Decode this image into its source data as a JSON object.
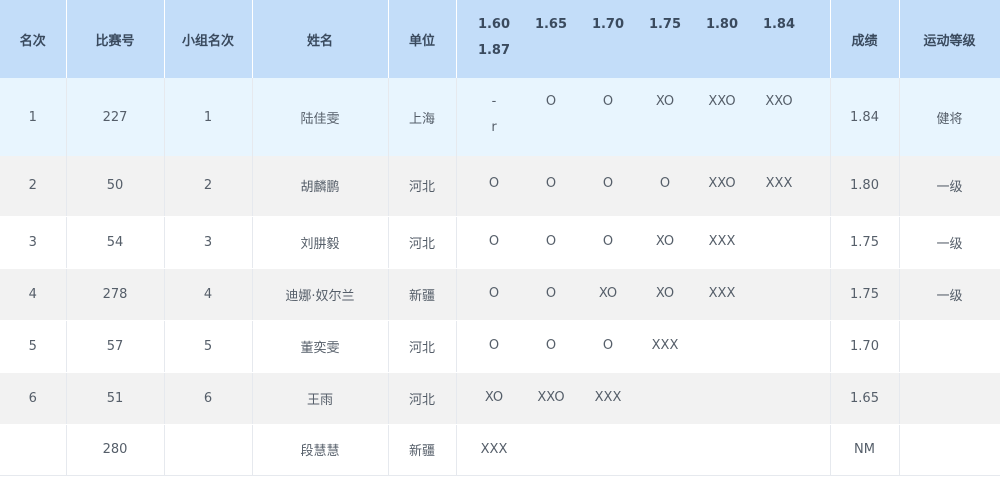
{
  "columns": {
    "rank": "名次",
    "bib": "比赛号",
    "group_rank": "小组名次",
    "name": "姓名",
    "unit": "单位",
    "result": "成绩",
    "grade": "运动等级"
  },
  "heights": [
    "1.60",
    "1.65",
    "1.70",
    "1.75",
    "1.80",
    "1.84"
  ],
  "heights_row2": "1.87",
  "rows": [
    {
      "rank": "1",
      "bib": "227",
      "group_rank": "1",
      "name": "陆佳雯",
      "unit": "上海",
      "attempts": [
        "-",
        "O",
        "O",
        "XO",
        "XXO",
        "XXO"
      ],
      "attempts_extra": "r",
      "result": "1.84",
      "grade": "健将"
    },
    {
      "rank": "2",
      "bib": "50",
      "group_rank": "2",
      "name": "胡麟鹏",
      "unit": "河北",
      "attempts": [
        "O",
        "O",
        "O",
        "O",
        "XXO",
        "XXX"
      ],
      "attempts_extra": "",
      "result": "1.80",
      "grade": "一级"
    },
    {
      "rank": "3",
      "bib": "54",
      "group_rank": "3",
      "name": "刘肼毅",
      "unit": "河北",
      "attempts": [
        "O",
        "O",
        "O",
        "XO",
        "XXX",
        ""
      ],
      "attempts_extra": "",
      "result": "1.75",
      "grade": "一级"
    },
    {
      "rank": "4",
      "bib": "278",
      "group_rank": "4",
      "name": "迪娜·奴尔兰",
      "unit": "新疆",
      "attempts": [
        "O",
        "O",
        "XO",
        "XO",
        "XXX",
        ""
      ],
      "attempts_extra": "",
      "result": "1.75",
      "grade": "一级"
    },
    {
      "rank": "5",
      "bib": "57",
      "group_rank": "5",
      "name": "董奕雯",
      "unit": "河北",
      "attempts": [
        "O",
        "O",
        "O",
        "XXX",
        "",
        ""
      ],
      "attempts_extra": "",
      "result": "1.70",
      "grade": ""
    },
    {
      "rank": "6",
      "bib": "51",
      "group_rank": "6",
      "name": "王雨",
      "unit": "河北",
      "attempts": [
        "XO",
        "XXO",
        "XXX",
        "",
        "",
        ""
      ],
      "attempts_extra": "",
      "result": "1.65",
      "grade": ""
    },
    {
      "rank": "",
      "bib": "280",
      "group_rank": "",
      "name": "段慧慧",
      "unit": "新疆",
      "attempts": [
        "XXX",
        "",
        "",
        "",
        "",
        ""
      ],
      "attempts_extra": "",
      "result": "NM",
      "grade": ""
    }
  ],
  "colors": {
    "header_bg": "#c3ddf9",
    "highlight_row_bg": "#e8f5fe",
    "striped_row_bg": "#f2f2f2",
    "text": "#555e69"
  }
}
